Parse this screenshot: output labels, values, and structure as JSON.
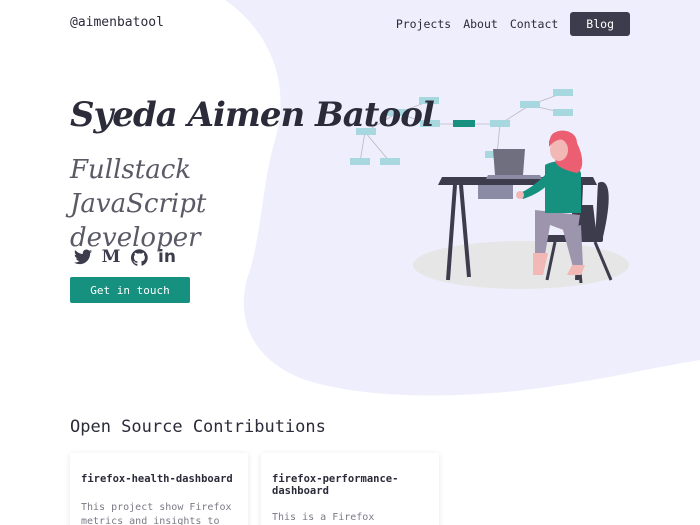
{
  "nav": {
    "brand": "@aimenbatool",
    "links": [
      "Projects",
      "About",
      "Contact"
    ],
    "blog_label": "Blog"
  },
  "hero": {
    "name": "Syeda Aimen Batool",
    "role": "Fullstack JavaScript developer",
    "cta_label": "Get in touch"
  },
  "socials": [
    {
      "icon": "twitter-icon",
      "glyph": ""
    },
    {
      "icon": "medium-icon",
      "glyph": "M"
    },
    {
      "icon": "github-icon",
      "glyph": ""
    },
    {
      "icon": "linkedin-icon",
      "glyph": "in"
    }
  ],
  "section": {
    "title": "Open Source Contributions"
  },
  "projects": [
    {
      "title": "firefox-health-dashboard",
      "description": "This project show Firefox metrics and insights to help"
    },
    {
      "title": "firefox-performance-dashboard",
      "description": "This is a Firefox"
    }
  ],
  "colors": {
    "accent": "#17917f",
    "background_blob": "#efeefd",
    "dark": "#3c3c4d"
  }
}
